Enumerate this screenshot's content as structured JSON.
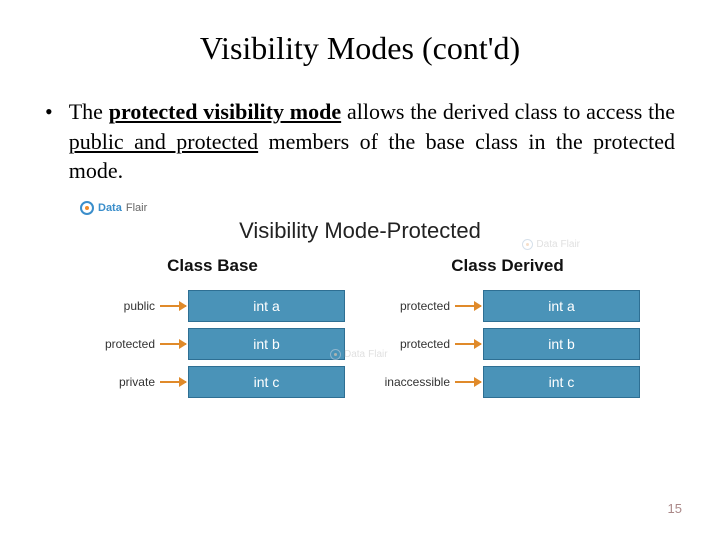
{
  "title": "Visibility Modes (cont'd)",
  "bullet": {
    "pre": "The ",
    "emph": "protected visibility mode",
    "mid": " allows the derived class to access the ",
    "u": "public and protected",
    "post": " members of the base class in the protected mode."
  },
  "brand": {
    "a": "Data",
    "b": "Flair"
  },
  "diagram": {
    "title": "Visibility Mode-Protected",
    "base": {
      "head": "Class Base",
      "rows": [
        {
          "label": "public",
          "cell": "int a"
        },
        {
          "label": "protected",
          "cell": "int b"
        },
        {
          "label": "private",
          "cell": "int c"
        }
      ]
    },
    "derived": {
      "head": "Class Derived",
      "rows": [
        {
          "label": "protected",
          "cell": "int a"
        },
        {
          "label": "protected",
          "cell": "int b"
        },
        {
          "label": "inaccessible",
          "cell": "int c"
        }
      ]
    }
  },
  "page": "15"
}
